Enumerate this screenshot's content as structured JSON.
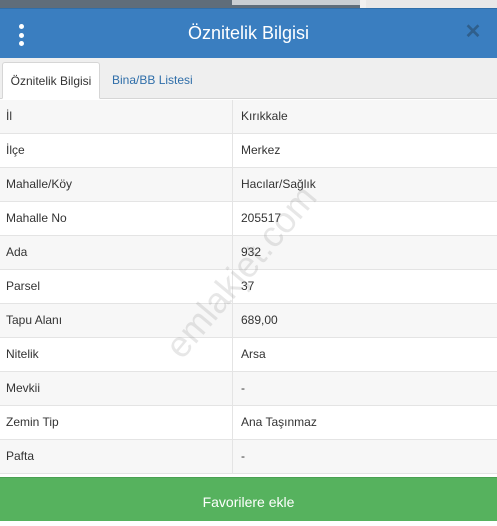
{
  "header": {
    "title": "Öznitelik Bilgisi",
    "menu_icon": "vertical-ellipsis-icon",
    "close_icon": "close-icon",
    "close_glyph": "✕"
  },
  "tabs": [
    {
      "label": "Öznitelik Bilgisi",
      "active": true
    },
    {
      "label": "Bina/BB Listesi",
      "active": false
    }
  ],
  "rows": [
    {
      "label": "İl",
      "value": "Kırıkkale"
    },
    {
      "label": "İlçe",
      "value": "Merkez"
    },
    {
      "label": "Mahalle/Köy",
      "value": "Hacılar/Sağlık"
    },
    {
      "label": "Mahalle No",
      "value": "205517"
    },
    {
      "label": "Ada",
      "value": "932"
    },
    {
      "label": "Parsel",
      "value": "37"
    },
    {
      "label": "Tapu Alanı",
      "value": "689,00"
    },
    {
      "label": "Nitelik",
      "value": "Arsa"
    },
    {
      "label": "Mevkii",
      "value": "-"
    },
    {
      "label": "Zemin Tip",
      "value": "Ana Taşınmaz"
    },
    {
      "label": "Pafta",
      "value": "-"
    }
  ],
  "watermark": "emlakjet.com",
  "footer": {
    "button_label": "Favorilere ekle"
  },
  "colors": {
    "header": "#3a7ec0",
    "footer": "#56b25e",
    "tab_link": "#2f6ea9"
  }
}
